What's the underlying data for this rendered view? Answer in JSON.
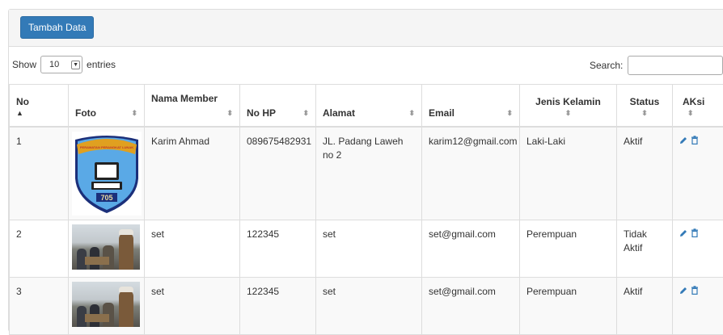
{
  "toolbar": {
    "add_label": "Tambah Data"
  },
  "length": {
    "show": "Show",
    "value": "10",
    "entries": "entries"
  },
  "search": {
    "label": "Search:",
    "value": ""
  },
  "columns": [
    {
      "label": "No",
      "sorted": "asc"
    },
    {
      "label": "Foto"
    },
    {
      "label": "Nama Member"
    },
    {
      "label": "No HP"
    },
    {
      "label": "Alamat"
    },
    {
      "label": "Email"
    },
    {
      "label": "Jenis Kelamin"
    },
    {
      "label": "Status"
    },
    {
      "label": "AKsi"
    }
  ],
  "rows": [
    {
      "no": "1",
      "foto": "logo",
      "nama": "Karim Ahmad",
      "hp": "089675482931",
      "alamat": "JL. Padang Laweh no 2",
      "email": "karim12@gmail.com",
      "jk": "Laki-Laki",
      "status": "Aktif"
    },
    {
      "no": "2",
      "foto": "photo",
      "nama": "set",
      "hp": "122345",
      "alamat": "set",
      "email": "set@gmail.com",
      "jk": "Perempuan",
      "status": "Tidak Aktif"
    },
    {
      "no": "3",
      "foto": "photo",
      "nama": "set",
      "hp": "122345",
      "alamat": "set",
      "email": "set@gmail.com",
      "jk": "Perempuan",
      "status": "Aktif"
    }
  ],
  "logo": {
    "arc_text": "PERAWATAN PERANGKAT LUNAK",
    "number": "705"
  },
  "colors": {
    "primary": "#337ab7",
    "icon": "#337ab7",
    "shield_blue": "#5aa9e6",
    "shield_border": "#1b2f7a",
    "banner": "#e0a020"
  }
}
